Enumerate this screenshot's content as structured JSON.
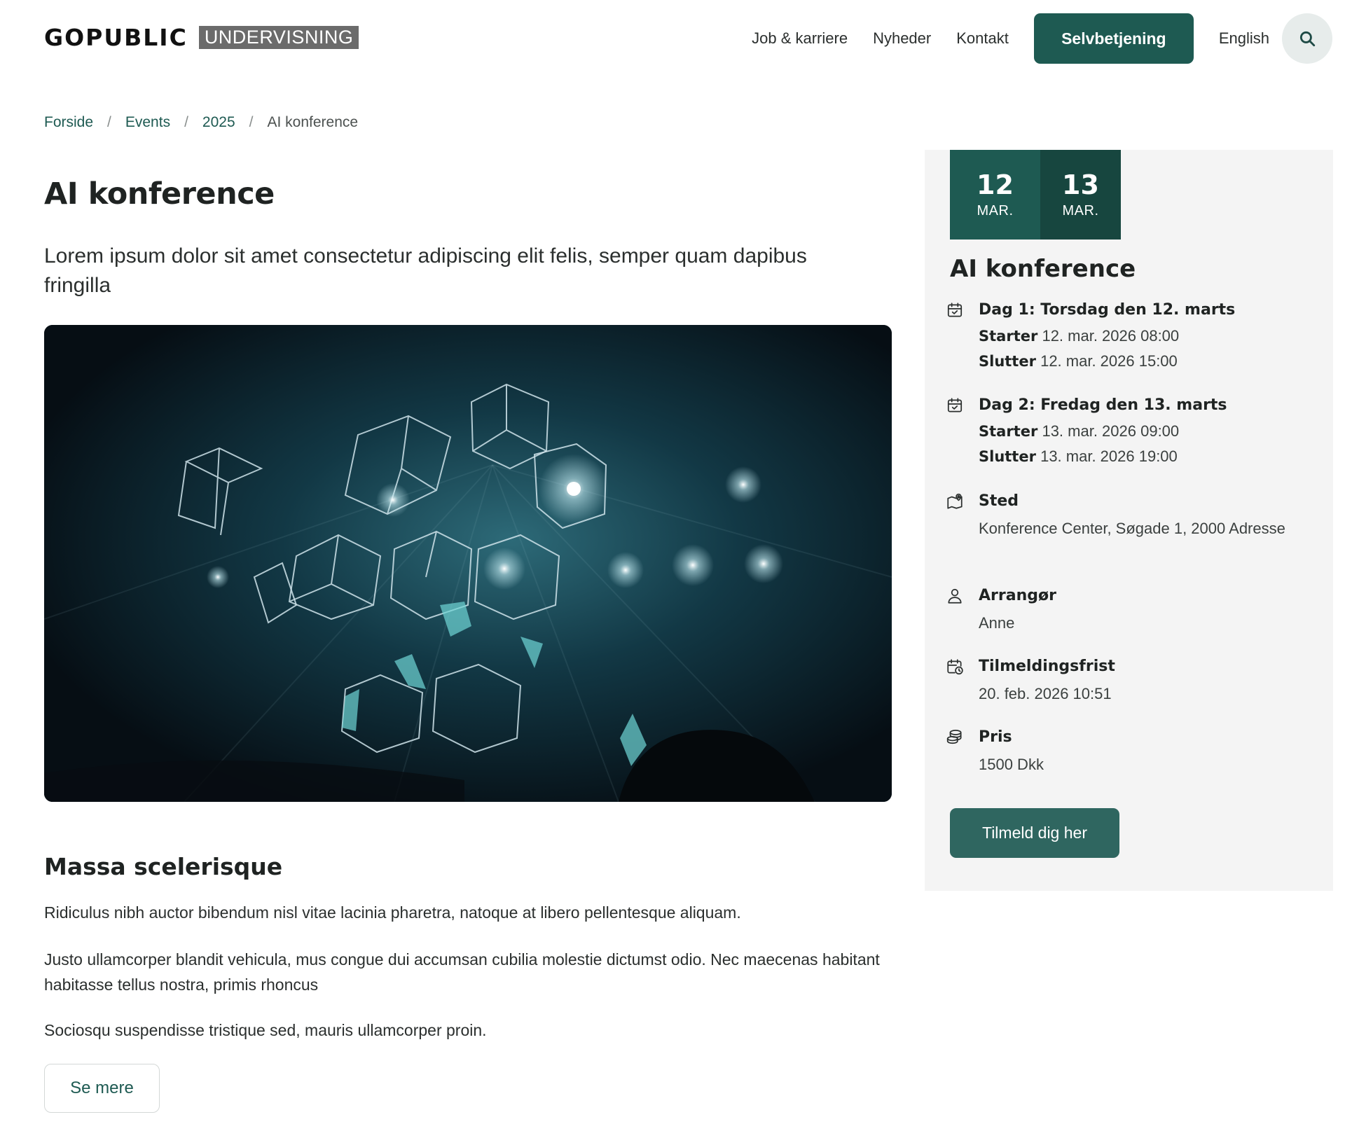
{
  "brand": {
    "name": "GOPUBLIC",
    "sub": "UNDERVISNING"
  },
  "nav": {
    "links": [
      "Job & karriere",
      "Nyheder",
      "Kontakt"
    ],
    "cta": "Selvbetjening",
    "language": "English",
    "search_icon": "search-icon"
  },
  "breadcrumb": {
    "items": [
      "Forside",
      "Events",
      "2025"
    ],
    "separator": "/",
    "current": "AI konference"
  },
  "main": {
    "title": "AI konference",
    "lead": "Lorem ipsum dolor sit amet consectetur adipiscing elit felis, semper quam dapibus fringilla",
    "heading": "Massa scelerisque",
    "paragraphs": [
      "Ridiculus nibh auctor bibendum nisl vitae lacinia pharetra, natoque at libero pellentesque aliquam.",
      "Justo ullamcorper blandit vehicula, mus congue dui accumsan cubilia molestie dictumst odio. Nec maecenas habitant habitasse tellus nostra, primis rhoncus",
      "Sociosqu suspendisse tristique sed, mauris ullamcorper proin."
    ],
    "more_button": "Se mere"
  },
  "event": {
    "dates": [
      {
        "day": "12",
        "month": "MAR."
      },
      {
        "day": "13",
        "month": "MAR."
      }
    ],
    "title": "AI konference",
    "day1": {
      "label": "Dag 1: Torsdag den 12. marts",
      "start_label": "Starter",
      "start": "12. mar. 2026 08:00",
      "end_label": "Slutter",
      "end": "12. mar. 2026 15:00"
    },
    "day2": {
      "label": "Dag 2: Fredag den 13. marts",
      "start_label": "Starter",
      "start": "13. mar. 2026 09:00",
      "end_label": "Slutter",
      "end": "13. mar. 2026 19:00"
    },
    "location": {
      "label": "Sted",
      "value": "Konference Center, Søgade 1, 2000 Adresse"
    },
    "organizer": {
      "label": "Arrangør",
      "value": "Anne"
    },
    "deadline": {
      "label": "Tilmeldingsfrist",
      "value": "20. feb. 2026 10:51"
    },
    "price": {
      "label": "Pris",
      "value": "1500 Dkk"
    },
    "signup_button": "Tilmeld dig her"
  },
  "colors": {
    "accent": "#1e5a52",
    "accent_dark": "#17463f",
    "sidebar_bg": "#f4f4f4"
  }
}
